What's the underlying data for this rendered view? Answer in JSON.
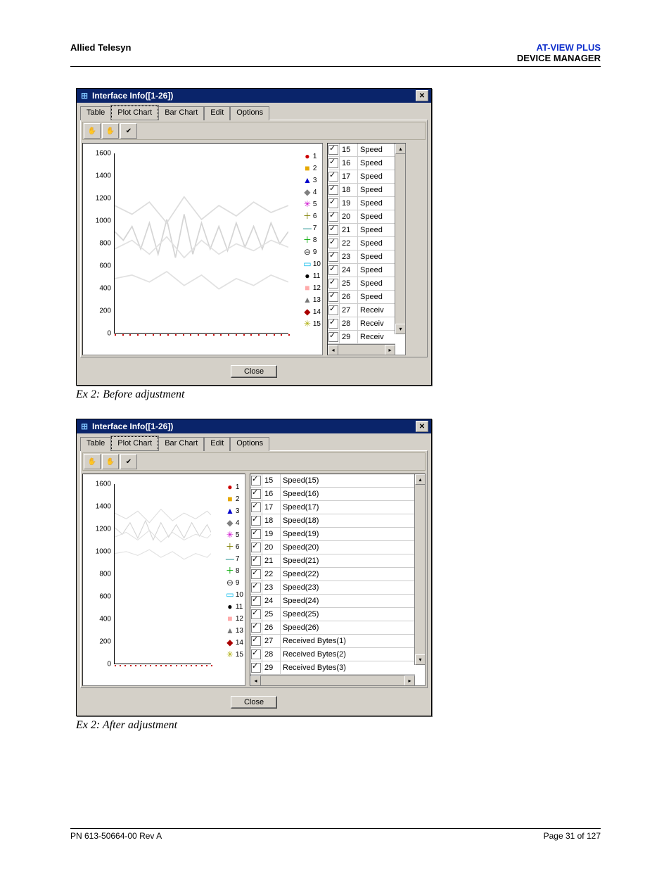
{
  "header": {
    "left": "Allied Telesyn",
    "right_brand": "AT-VIEW PLUS",
    "right_sub": "DEVICE MANAGER"
  },
  "footer": {
    "left": "PN 613-50664-00 Rev A",
    "right": "Page 31 of 127"
  },
  "captions": {
    "before": "Ex 2: Before adjustment",
    "after": "Ex 2: After adjustment"
  },
  "window": {
    "title": "Interface Info([1-26])",
    "tabs": [
      "Table",
      "Plot Chart",
      "Bar Chart",
      "Edit",
      "Options"
    ],
    "active_tab": "Plot Chart",
    "close_label": "Close"
  },
  "chart_data": {
    "type": "line",
    "ylabel": "",
    "xlabel": "",
    "ylim": [
      0,
      1600
    ],
    "yticks": [
      0,
      200,
      400,
      600,
      800,
      1000,
      1200,
      1400,
      1600
    ],
    "series_count": 15,
    "legend": [
      {
        "id": "1",
        "marker": "●",
        "color": "#cc0000"
      },
      {
        "id": "2",
        "marker": "■",
        "color": "#e6a800"
      },
      {
        "id": "3",
        "marker": "▲",
        "color": "#0000cc"
      },
      {
        "id": "4",
        "marker": "◆",
        "color": "#808080"
      },
      {
        "id": "5",
        "marker": "✳",
        "color": "#cc00cc"
      },
      {
        "id": "6",
        "marker": "＋",
        "color": "#808000"
      },
      {
        "id": "7",
        "marker": "—",
        "color": "#008080"
      },
      {
        "id": "8",
        "marker": "＋",
        "color": "#00aa00"
      },
      {
        "id": "9",
        "marker": "⊖",
        "color": "#333333"
      },
      {
        "id": "10",
        "marker": "▭",
        "color": "#00b7eb"
      },
      {
        "id": "11",
        "marker": "●",
        "color": "#000000"
      },
      {
        "id": "12",
        "marker": "■",
        "color": "#ffaaaa"
      },
      {
        "id": "13",
        "marker": "▲",
        "color": "#777777"
      },
      {
        "id": "14",
        "marker": "◆",
        "color": "#aa0000"
      },
      {
        "id": "15",
        "marker": "✳",
        "color": "#aaaa00"
      }
    ],
    "note": "multiple overlapping line traces between y~200 and y~1300; series 1-3 vary, many series flat near 0"
  },
  "side_before": [
    {
      "n": "15",
      "label": "Speed"
    },
    {
      "n": "16",
      "label": "Speed"
    },
    {
      "n": "17",
      "label": "Speed"
    },
    {
      "n": "18",
      "label": "Speed"
    },
    {
      "n": "19",
      "label": "Speed"
    },
    {
      "n": "20",
      "label": "Speed"
    },
    {
      "n": "21",
      "label": "Speed"
    },
    {
      "n": "22",
      "label": "Speed"
    },
    {
      "n": "23",
      "label": "Speed"
    },
    {
      "n": "24",
      "label": "Speed"
    },
    {
      "n": "25",
      "label": "Speed"
    },
    {
      "n": "26",
      "label": "Speed"
    },
    {
      "n": "27",
      "label": "Receiv"
    },
    {
      "n": "28",
      "label": "Receiv"
    },
    {
      "n": "29",
      "label": "Receiv"
    }
  ],
  "side_after": [
    {
      "n": "15",
      "label": "Speed(15)"
    },
    {
      "n": "16",
      "label": "Speed(16)"
    },
    {
      "n": "17",
      "label": "Speed(17)"
    },
    {
      "n": "18",
      "label": "Speed(18)"
    },
    {
      "n": "19",
      "label": "Speed(19)"
    },
    {
      "n": "20",
      "label": "Speed(20)"
    },
    {
      "n": "21",
      "label": "Speed(21)"
    },
    {
      "n": "22",
      "label": "Speed(22)"
    },
    {
      "n": "23",
      "label": "Speed(23)"
    },
    {
      "n": "24",
      "label": "Speed(24)"
    },
    {
      "n": "25",
      "label": "Speed(25)"
    },
    {
      "n": "26",
      "label": "Speed(26)"
    },
    {
      "n": "27",
      "label": "Received Bytes(1)"
    },
    {
      "n": "28",
      "label": "Received Bytes(2)"
    },
    {
      "n": "29",
      "label": "Received Bytes(3)"
    }
  ]
}
